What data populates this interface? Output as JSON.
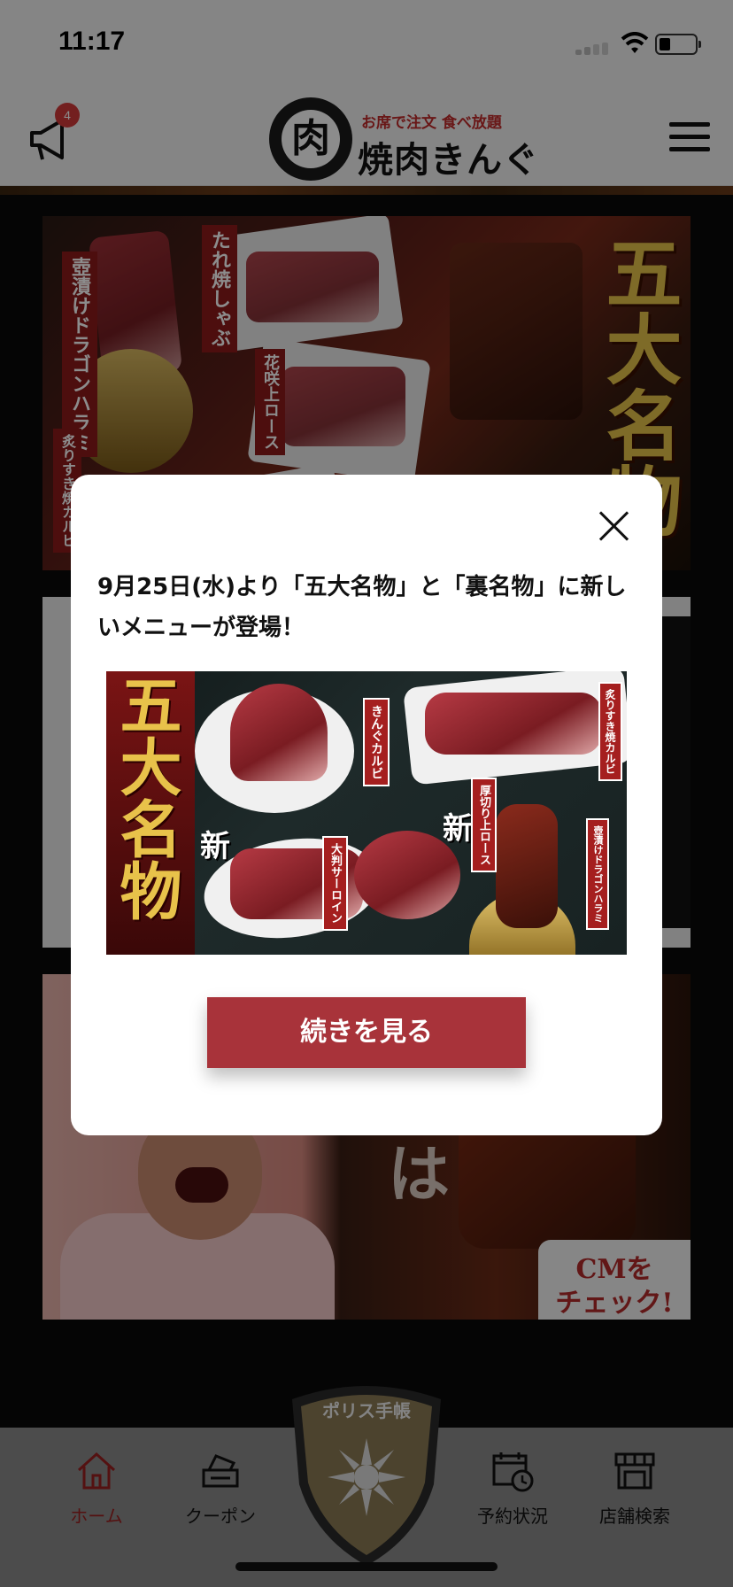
{
  "status_bar": {
    "time": "11:17"
  },
  "header": {
    "notification_count": "4",
    "logo": {
      "tagline": "お席で注文 食べ放題",
      "emblem": "肉",
      "name": "焼肉きんぐ"
    }
  },
  "background": {
    "banner1": {
      "headline": "五大名物",
      "labels": [
        "壺漬けドラゴンハラミ",
        "たれ焼しゃぶ",
        "花咲上ロース",
        "炙りすき焼カルビ"
      ]
    },
    "banner3": {
      "big_text": "は",
      "cm_line1": "CMを",
      "cm_line2": "チェック!"
    }
  },
  "modal": {
    "title": "9月25日(水)より「五大名物」と「裏名物」に新しいメニューが登場！",
    "image": {
      "headline": "五大名物",
      "new_mark": "新",
      "tags": [
        "きんぐカルビ",
        "炙りすき焼カルビ",
        "厚切り上ロース",
        "大判サーロイン",
        "壺漬けドラゴンハラミ"
      ]
    },
    "button_label": "続きを見る"
  },
  "tab_bar": {
    "items": [
      {
        "label": "ホーム",
        "icon": "home-icon",
        "active": true
      },
      {
        "label": "クーポン",
        "icon": "coupon-icon",
        "active": false
      },
      {
        "label": "予約状況",
        "icon": "calendar-clock-icon",
        "active": false
      },
      {
        "label": "店舗検索",
        "icon": "store-icon",
        "active": false
      }
    ],
    "center_badge": "ポリス手帳"
  },
  "colors": {
    "accent": "#a8333a",
    "active_tab": "#9a2020",
    "badge": "#d23a3a"
  }
}
